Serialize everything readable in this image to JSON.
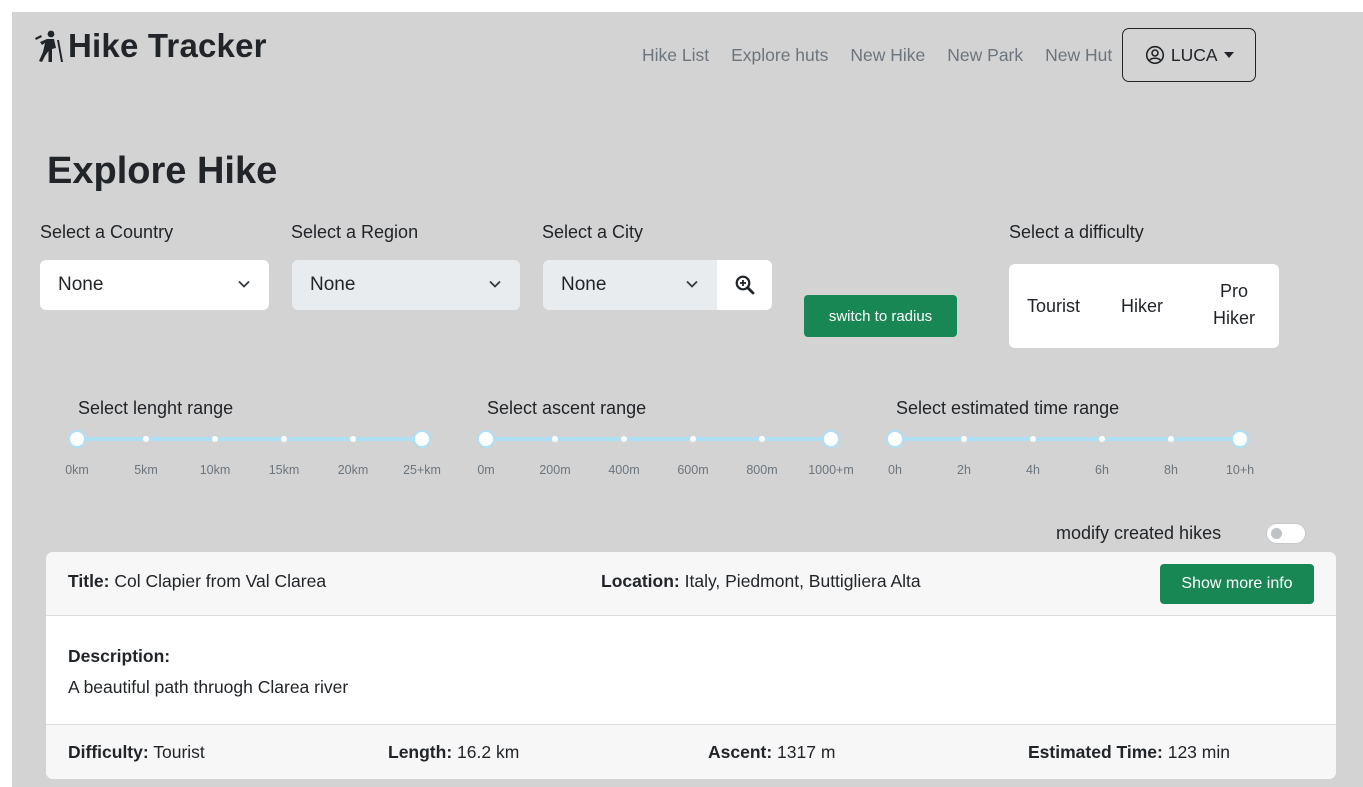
{
  "navbar": {
    "brand": "Hike Tracker",
    "links": [
      "Hike List",
      "Explore huts",
      "New Hike",
      "New Park",
      "New Hut"
    ],
    "user": "LUCA"
  },
  "page_title": "Explore Hike",
  "filters": {
    "country": {
      "label": "Select a Country",
      "value": "None"
    },
    "region": {
      "label": "Select a Region",
      "value": "None"
    },
    "city": {
      "label": "Select a City",
      "value": "None"
    },
    "switch_label": "switch to radius",
    "difficulty": {
      "label": "Select a difficulty",
      "options": [
        "Tourist",
        "Hiker",
        "Pro Hiker"
      ]
    }
  },
  "sliders": {
    "length": {
      "label": "Select lenght range",
      "ticks": [
        "0km",
        "5km",
        "10km",
        "15km",
        "20km",
        "25+km"
      ]
    },
    "ascent": {
      "label": "Select ascent range",
      "ticks": [
        "0m",
        "200m",
        "400m",
        "600m",
        "800m",
        "1000+m"
      ]
    },
    "time": {
      "label": "Select estimated time range",
      "ticks": [
        "0h",
        "2h",
        "4h",
        "6h",
        "8h",
        "10+h"
      ]
    }
  },
  "modify_toggle": {
    "label": "modify created hikes",
    "on": false
  },
  "hike": {
    "title_label": "Title:",
    "title": " Col Clapier from Val Clarea",
    "location_label": "Location:",
    "location": " Italy, Piedmont, Buttigliera Alta",
    "more_info": "Show more info",
    "description_label": "Description:",
    "description": "A beautiful path thruogh Clarea river",
    "difficulty_label": "Difficulty:",
    "difficulty": " Tourist",
    "length_label": "Length:",
    "length": " 16.2 km",
    "ascent_label": "Ascent:",
    "ascent": " 1317 m",
    "time_label": "Estimated Time:",
    "time": " 123 min"
  },
  "colors": {
    "background": "#d3d3d3",
    "accent_green": "#198754",
    "slider_blue": "#aee0f5"
  }
}
